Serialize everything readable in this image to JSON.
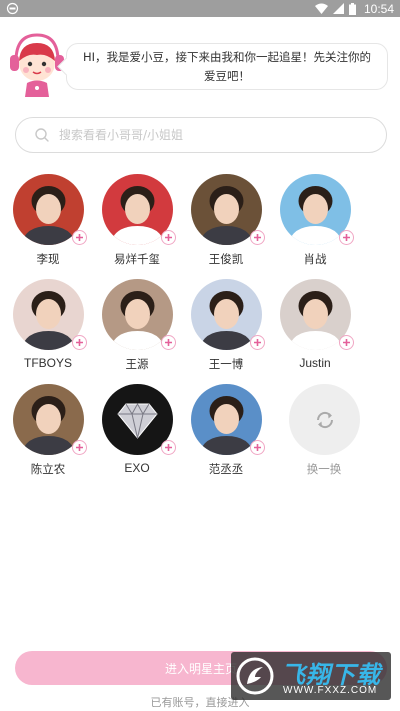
{
  "status_bar": {
    "time": "10:54"
  },
  "welcome": {
    "message": "HI，我是爱小豆，接下来由我和你一起追星！先关注你的爱豆吧！"
  },
  "search": {
    "placeholder": "搜索看看小哥哥/小姐姐"
  },
  "idols": [
    {
      "name": "李现",
      "bg": "#c04030"
    },
    {
      "name": "易烊千玺",
      "bg": "#d23a3e"
    },
    {
      "name": "王俊凯",
      "bg": "#6b5138"
    },
    {
      "name": "肖战",
      "bg": "#7fbfe6"
    },
    {
      "name": "TFBOYS",
      "bg": "#e8d5d0"
    },
    {
      "name": "王源",
      "bg": "#b59985"
    },
    {
      "name": "王一博",
      "bg": "#c9d4e6"
    },
    {
      "name": "Justin",
      "bg": "#d9d0cc"
    },
    {
      "name": "陈立农",
      "bg": "#8a6a4c"
    },
    {
      "name": "EXO",
      "bg": "#151515"
    },
    {
      "name": "范丞丞",
      "bg": "#5a8fc8"
    }
  ],
  "refresh": {
    "label": "换一换"
  },
  "footer": {
    "enter_label": "进入明星主页",
    "login_text": "已有账号，直接进入"
  },
  "watermark": {
    "brand": "飞翔下载",
    "url": "WWW.FXXZ.COM"
  },
  "colors": {
    "accent_pink": "#f7b6cf",
    "plus_pink": "#e4609a"
  }
}
